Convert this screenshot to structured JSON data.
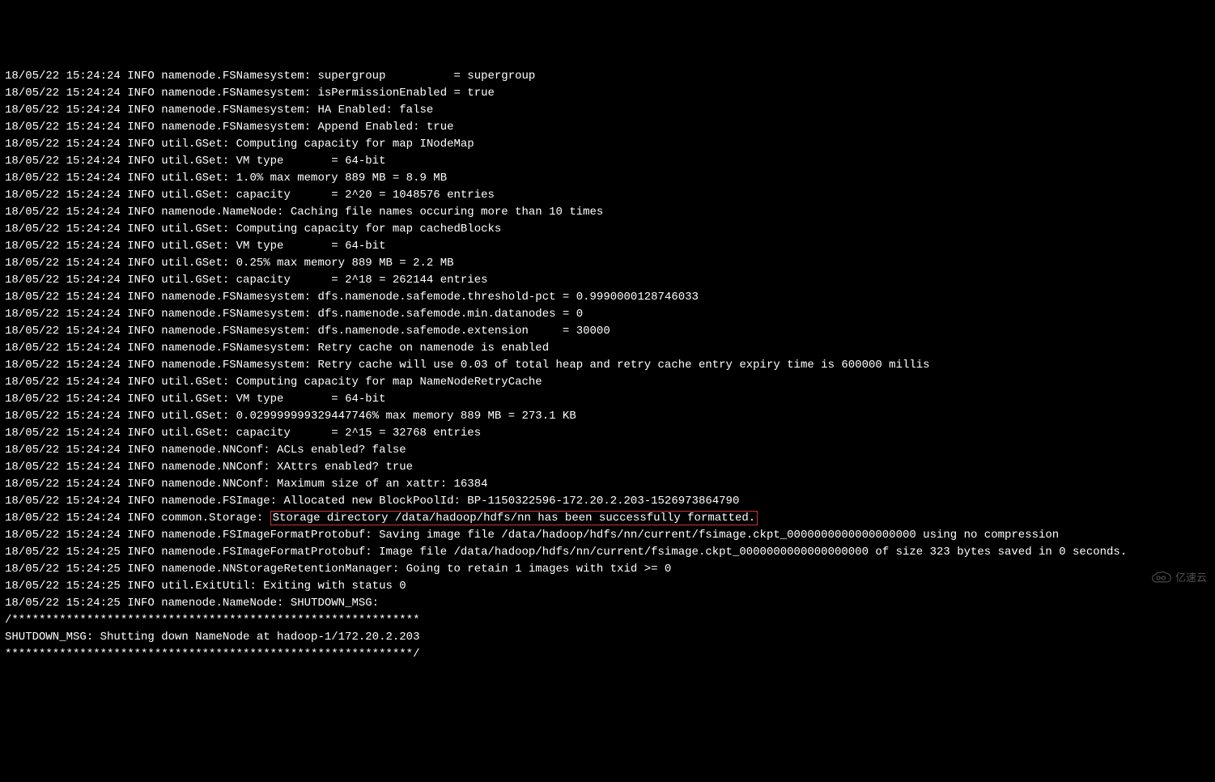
{
  "log": {
    "lines": [
      "18/05/22 15:24:24 INFO namenode.FSNamesystem: supergroup          = supergroup",
      "18/05/22 15:24:24 INFO namenode.FSNamesystem: isPermissionEnabled = true",
      "18/05/22 15:24:24 INFO namenode.FSNamesystem: HA Enabled: false",
      "18/05/22 15:24:24 INFO namenode.FSNamesystem: Append Enabled: true",
      "18/05/22 15:24:24 INFO util.GSet: Computing capacity for map INodeMap",
      "18/05/22 15:24:24 INFO util.GSet: VM type       = 64-bit",
      "18/05/22 15:24:24 INFO util.GSet: 1.0% max memory 889 MB = 8.9 MB",
      "18/05/22 15:24:24 INFO util.GSet: capacity      = 2^20 = 1048576 entries",
      "18/05/22 15:24:24 INFO namenode.NameNode: Caching file names occuring more than 10 times",
      "18/05/22 15:24:24 INFO util.GSet: Computing capacity for map cachedBlocks",
      "18/05/22 15:24:24 INFO util.GSet: VM type       = 64-bit",
      "18/05/22 15:24:24 INFO util.GSet: 0.25% max memory 889 MB = 2.2 MB",
      "18/05/22 15:24:24 INFO util.GSet: capacity      = 2^18 = 262144 entries",
      "18/05/22 15:24:24 INFO namenode.FSNamesystem: dfs.namenode.safemode.threshold-pct = 0.9990000128746033",
      "18/05/22 15:24:24 INFO namenode.FSNamesystem: dfs.namenode.safemode.min.datanodes = 0",
      "18/05/22 15:24:24 INFO namenode.FSNamesystem: dfs.namenode.safemode.extension     = 30000",
      "18/05/22 15:24:24 INFO namenode.FSNamesystem: Retry cache on namenode is enabled",
      "18/05/22 15:24:24 INFO namenode.FSNamesystem: Retry cache will use 0.03 of total heap and retry cache entry expiry time is 600000 millis",
      "18/05/22 15:24:24 INFO util.GSet: Computing capacity for map NameNodeRetryCache",
      "18/05/22 15:24:24 INFO util.GSet: VM type       = 64-bit",
      "18/05/22 15:24:24 INFO util.GSet: 0.029999999329447746% max memory 889 MB = 273.1 KB",
      "18/05/22 15:24:24 INFO util.GSet: capacity      = 2^15 = 32768 entries",
      "18/05/22 15:24:24 INFO namenode.NNConf: ACLs enabled? false",
      "18/05/22 15:24:24 INFO namenode.NNConf: XAttrs enabled? true",
      "18/05/22 15:24:24 INFO namenode.NNConf: Maximum size of an xattr: 16384",
      "18/05/22 15:24:24 INFO namenode.FSImage: Allocated new BlockPoolId: BP-1150322596-172.20.2.203-1526973864790"
    ],
    "highlighted_line_prefix": "18/05/22 15:24:24 INFO common.Storage: ",
    "highlighted_text": "Storage directory /data/hadoop/hdfs/nn has been successfully formatted.",
    "lines_after": [
      "18/05/22 15:24:24 INFO namenode.FSImageFormatProtobuf: Saving image file /data/hadoop/hdfs/nn/current/fsimage.ckpt_0000000000000000000 using no compression",
      "18/05/22 15:24:25 INFO namenode.FSImageFormatProtobuf: Image file /data/hadoop/hdfs/nn/current/fsimage.ckpt_0000000000000000000 of size 323 bytes saved in 0 seconds.",
      "18/05/22 15:24:25 INFO namenode.NNStorageRetentionManager: Going to retain 1 images with txid >= 0",
      "18/05/22 15:24:25 INFO util.ExitUtil: Exiting with status 0",
      "18/05/22 15:24:25 INFO namenode.NameNode: SHUTDOWN_MSG:",
      "/************************************************************",
      "SHUTDOWN_MSG: Shutting down NameNode at hadoop-1/172.20.2.203",
      "************************************************************/"
    ]
  },
  "watermark": {
    "text": "亿速云"
  }
}
